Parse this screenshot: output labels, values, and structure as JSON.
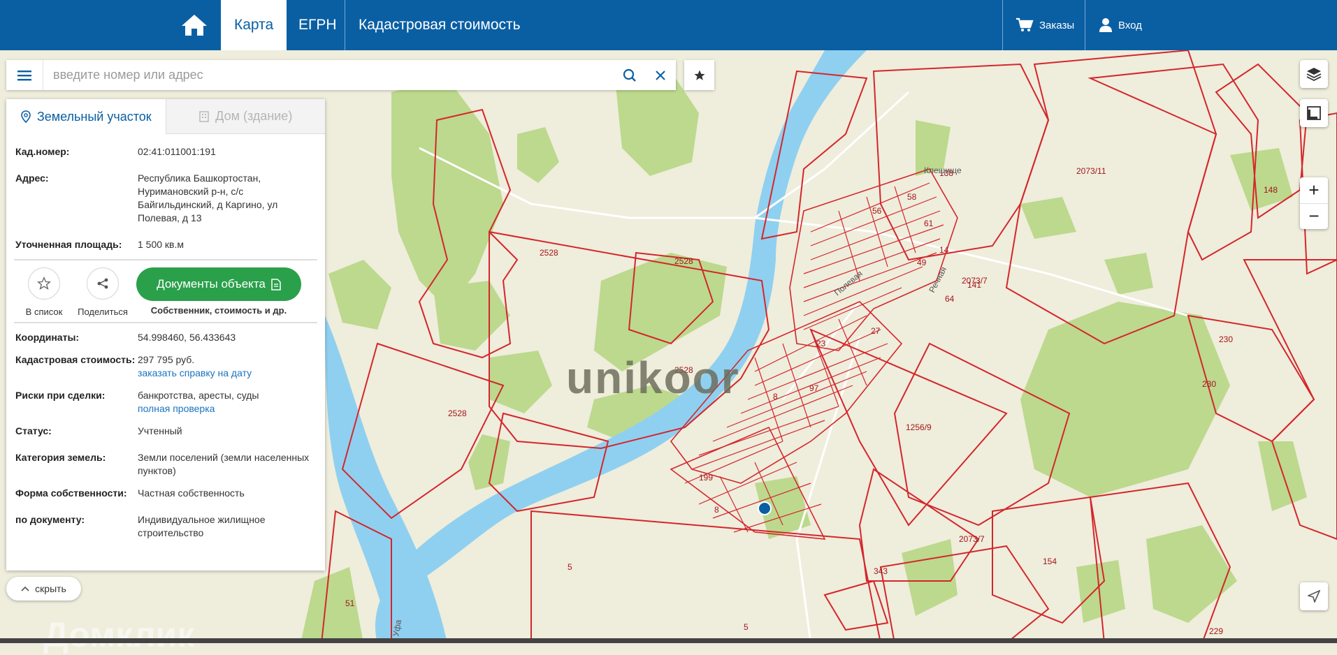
{
  "nav": {
    "tabs": [
      "Карта",
      "ЕГРН",
      "Кадастровая стоимость"
    ],
    "orders": "Заказы",
    "login": "Вход"
  },
  "search": {
    "placeholder": "введите номер или адрес"
  },
  "panel": {
    "tab_land": "Земельный участок",
    "tab_house": "Дом (здание)",
    "rows": [
      {
        "label": "Кад.номер:",
        "value": "02:41:011001:191"
      },
      {
        "label": "Адрес:",
        "value": "Республика Башкортостан, Нуримановский р-н, с/с Байгильдинский, д Каргино, ул Полевая, д 13"
      },
      {
        "label": "Уточненная площадь:",
        "value": "1 500 кв.м"
      }
    ],
    "actions": {
      "add_to_list": "В список",
      "share": "Поделиться",
      "docs_button": "Документы объекта",
      "docs_sub": "Собственник, стоимость и др."
    },
    "rows2": [
      {
        "label": "Координаты:",
        "value": "54.998460, 56.433643"
      },
      {
        "label": "Кадастровая стоимость:",
        "value": "297 795 руб.",
        "link": "заказать справку на дату"
      },
      {
        "label": "Риски при сделки:",
        "value": "банкротства, аресты, суды",
        "link": "полная проверка"
      },
      {
        "label": "Статус:",
        "value": "Учтенный"
      },
      {
        "label": "Категория земель:",
        "value": "Земли поселений (земли населенных пунктов)"
      },
      {
        "label": "Форма собственности:",
        "value": "Частная собственность"
      },
      {
        "label": "по документу:",
        "value": "Индивидуальное жилищное строительство"
      }
    ],
    "hide": "скрыть"
  },
  "map": {
    "labels": [
      "2528",
      "2528",
      "2528",
      "2528",
      "2073/11",
      "2073/7",
      "1256/9",
      "2073/7",
      "230",
      "230",
      "148",
      "154",
      "343",
      "229",
      "5",
      "5",
      "51",
      "8",
      "199",
      "8",
      "23",
      "27",
      "97",
      "49",
      "61",
      "14",
      "64",
      "141",
      "58",
      "56",
      "138",
      "Клещище",
      "Речная",
      "Полевая",
      "Уфа"
    ],
    "watermark": "unikoor",
    "watermark2": "Домклик"
  },
  "colors": {
    "nav": "#0a5fa3",
    "land": "#efeddc",
    "forest": "#bcd98d",
    "water": "#8fd0f0",
    "parcel": "#d4262c",
    "accent_green": "#2aa04a"
  }
}
